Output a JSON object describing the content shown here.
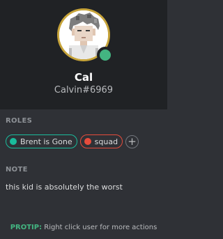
{
  "profile": {
    "username": "Cal",
    "tag": "Calvin#6969",
    "status": "online",
    "status_color": "#43b581",
    "avatar_ring_color": "#c7a43a"
  },
  "roles_section": {
    "label": "ROLES",
    "roles": [
      {
        "name": "Brent is Gone",
        "color": "#1abc9c"
      },
      {
        "name": "squad",
        "color": "#e74c3c"
      }
    ],
    "add_icon": "plus-icon"
  },
  "note_section": {
    "label": "NOTE",
    "text": "this kid is absolutely the worst"
  },
  "protip": {
    "label": "PROTIP:",
    "text": " Right click user for more actions",
    "label_color": "#43b581"
  }
}
